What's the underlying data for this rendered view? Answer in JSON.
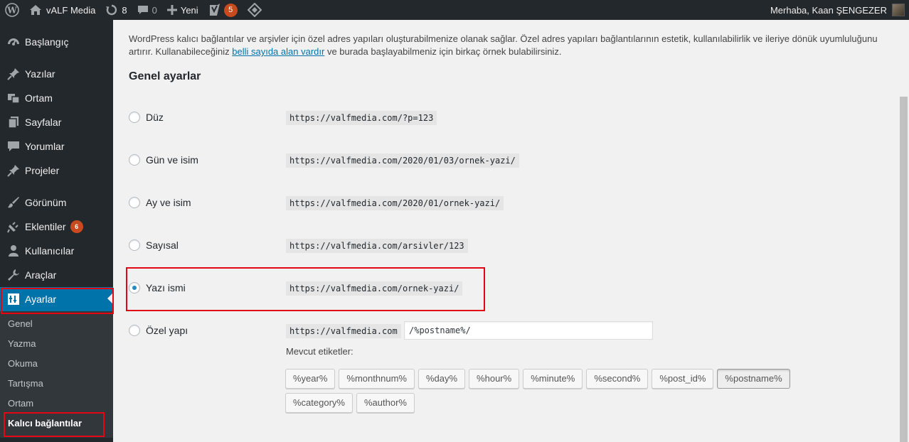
{
  "adminbar": {
    "site_name": "vALF Media",
    "updates_count": "8",
    "comments_count": "0",
    "new_label": "Yeni",
    "yoast_count": "5",
    "greeting": "Merhaba, Kaan ŞENGEZER"
  },
  "sidebar": {
    "items": [
      {
        "label": "Başlangıç",
        "icon": "dashboard-icon"
      },
      {
        "label": "Yazılar",
        "icon": "pin-icon"
      },
      {
        "label": "Ortam",
        "icon": "media-icon"
      },
      {
        "label": "Sayfalar",
        "icon": "page-icon"
      },
      {
        "label": "Yorumlar",
        "icon": "comment-icon"
      },
      {
        "label": "Projeler",
        "icon": "pin-icon"
      },
      {
        "label": "Görünüm",
        "icon": "brush-icon"
      },
      {
        "label": "Eklentiler",
        "icon": "plugin-icon",
        "badge": "6"
      },
      {
        "label": "Kullanıcılar",
        "icon": "users-icon"
      },
      {
        "label": "Araçlar",
        "icon": "wrench-icon"
      },
      {
        "label": "Ayarlar",
        "icon": "settings-icon"
      }
    ],
    "submenu": [
      "Genel",
      "Yazma",
      "Okuma",
      "Tartışma",
      "Ortam",
      "Kalıcı bağlantılar"
    ]
  },
  "main": {
    "intro_before_link": "WordPress kalıcı bağlantılar ve arşivler için özel adres yapıları oluşturabilmenize olanak sağlar. Özel adres yapıları bağlantılarının estetik, kullanılabilirlik ve ileriye dönük uyumluluğunu artırır. Kullanabileceğiniz ",
    "intro_link": "belli sayıda alan vardır",
    "intro_after_link": " ve burada başlayabilmeniz için birkaç örnek bulabilirsiniz.",
    "section_title": "Genel ayarlar",
    "options": [
      {
        "label": "Düz",
        "example": "https://valfmedia.com/?p=123",
        "checked": false
      },
      {
        "label": "Gün ve isim",
        "example": "https://valfmedia.com/2020/01/03/ornek-yazi/",
        "checked": false
      },
      {
        "label": "Ay ve isim",
        "example": "https://valfmedia.com/2020/01/ornek-yazi/",
        "checked": false
      },
      {
        "label": "Sayısal",
        "example": "https://valfmedia.com/arsivler/123",
        "checked": false
      },
      {
        "label": "Yazı ismi",
        "example": "https://valfmedia.com/ornek-yazi/",
        "checked": true
      },
      {
        "label": "Özel yapı",
        "example": "https://valfmedia.com",
        "checked": false
      }
    ],
    "custom_structure_value": "/%postname%/",
    "available_tags_label": "Mevcut etiketler:",
    "tags": [
      "%year%",
      "%monthnum%",
      "%day%",
      "%hour%",
      "%minute%",
      "%second%",
      "%post_id%",
      "%postname%",
      "%category%",
      "%author%"
    ],
    "pressed_tag": "%postname%"
  },
  "colors": {
    "sidebar_bg": "#23282d",
    "active_menu": "#0073aa",
    "badge": "#ca4a1f",
    "highlight_box": "#e30613"
  }
}
